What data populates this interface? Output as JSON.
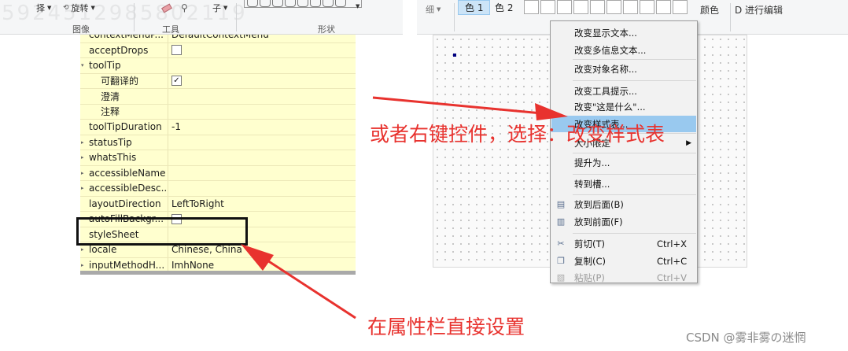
{
  "ribbon": {
    "select_label": "择",
    "rotate_label": "旋转",
    "text_label": "子",
    "groups": {
      "image": "图像",
      "tools": "工具",
      "shapes": "形状",
      "colors": "颜色"
    },
    "size_label": "细",
    "color1_label": "色 1",
    "color2_label": "色 2",
    "edit_colors_label": "颜色",
    "edit3d_label": "D 进行编辑",
    "watermark_digits": "5924512985802119"
  },
  "property_editor": {
    "rows": [
      {
        "name": "contextMenuP...",
        "value": "DefaultContextMenu",
        "expand": ""
      },
      {
        "name": "acceptDrops",
        "value": "",
        "checkbox": "unchecked",
        "expand": ""
      },
      {
        "name": "toolTip",
        "value": "",
        "expand": "down"
      },
      {
        "name": "可翻译的",
        "value": "",
        "checkbox": "checked",
        "expand": "",
        "sub": true
      },
      {
        "name": "澄清",
        "value": "",
        "expand": "",
        "sub": true
      },
      {
        "name": "注释",
        "value": "",
        "expand": "",
        "sub": true
      },
      {
        "name": "toolTipDuration",
        "value": "-1",
        "expand": ""
      },
      {
        "name": "statusTip",
        "value": "",
        "expand": "right"
      },
      {
        "name": "whatsThis",
        "value": "",
        "expand": "right"
      },
      {
        "name": "accessibleName",
        "value": "",
        "expand": "right"
      },
      {
        "name": "accessibleDesc...",
        "value": "",
        "expand": "right"
      },
      {
        "name": "layoutDirection",
        "value": "LeftToRight",
        "expand": ""
      },
      {
        "name": "autoFillBackgr...",
        "value": "",
        "checkbox": "unchecked",
        "expand": ""
      },
      {
        "name": "styleSheet",
        "value": "",
        "expand": ""
      },
      {
        "name": "locale",
        "value": "Chinese, China",
        "expand": "right"
      },
      {
        "name": "inputMethodH...",
        "value": "ImhNone",
        "expand": "right"
      }
    ]
  },
  "context_menu": {
    "items": [
      {
        "label": "改变显示文本...",
        "kind": "item"
      },
      {
        "label": "改变多信息文本...",
        "kind": "item"
      },
      {
        "label": "改变对象名称...",
        "kind": "item"
      },
      {
        "label": "改变工具提示...",
        "kind": "item"
      },
      {
        "label": "改变\"这是什么\"...",
        "kind": "item"
      },
      {
        "label": "改变样式表...",
        "kind": "item",
        "state": "active"
      },
      {
        "label": "大小限定",
        "kind": "submenu"
      },
      {
        "label": "提升为...",
        "kind": "item"
      },
      {
        "label": "转到槽...",
        "kind": "item"
      },
      {
        "label": "放到后面(B)",
        "kind": "item",
        "icon": "send-to-back-icon"
      },
      {
        "label": "放到前面(F)",
        "kind": "item",
        "icon": "bring-to-front-icon"
      },
      {
        "label": "剪切(T)",
        "shortcut": "Ctrl+X",
        "kind": "item",
        "icon": "scissors-icon"
      },
      {
        "label": "复制(C)",
        "shortcut": "Ctrl+C",
        "kind": "item",
        "icon": "copy-icon"
      },
      {
        "label": "粘贴(P)",
        "shortcut": "Ctrl+V",
        "kind": "item",
        "icon": "paste-icon",
        "state": "disabled"
      }
    ]
  },
  "annotations": {
    "right_click_hint": "或者右键控件，选择：改变样式表",
    "property_hint": "在属性栏直接设置"
  },
  "credit": "CSDN @雾非雾の迷惘",
  "colors": {
    "annotation_red": "#e8322e",
    "property_bg": "#ffffcf",
    "menu_highlight": "#99c9ef"
  }
}
